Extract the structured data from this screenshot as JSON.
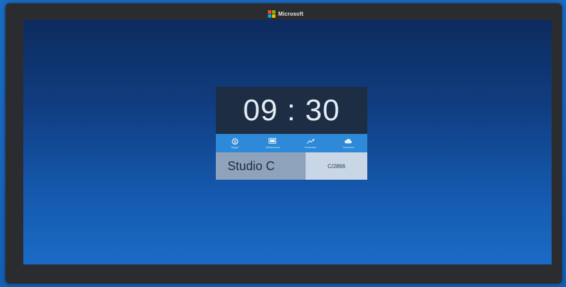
{
  "brand": {
    "name": "Microsoft",
    "logo_colors": [
      "#f25022",
      "#7fba00",
      "#00a4ef",
      "#ffb900"
    ]
  },
  "clock": {
    "time": "09 : 30"
  },
  "apps": [
    {
      "label": "Skype",
      "icon": "skype-icon"
    },
    {
      "label": "Whiteboard",
      "icon": "whiteboard-icon"
    },
    {
      "label": "Presenter",
      "icon": "projection-icon"
    },
    {
      "label": "OneDrive",
      "icon": "cloud-icon"
    }
  ],
  "room": {
    "name": "Studio C",
    "code": "C/2866"
  },
  "colors": {
    "accent": "#2e8ad8",
    "clock_bg": "#1d2d44",
    "room_bg": "#8fa2bb"
  }
}
